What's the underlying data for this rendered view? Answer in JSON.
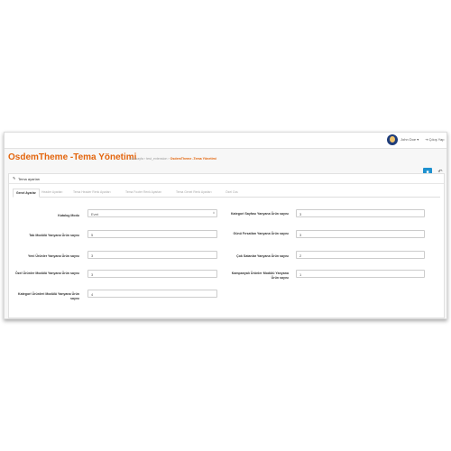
{
  "topbar": {
    "user_name": "John Doe ▾",
    "logout_label": "⇥ Çıkış Yap"
  },
  "header": {
    "title": "OsdemTheme -Tema Yönetimi",
    "breadcrumb": [
      "Anasayfa",
      "test_extension",
      "OsdemTheme -Tema Yönetimi"
    ],
    "breadcrumb_sep": " › "
  },
  "panel": {
    "title": "Tema ayarları"
  },
  "tabs": [
    "Genel Ayarlar",
    "Header Ayarları",
    "Tema Header Renk Ayarları",
    "Tema Footer Renk Ayarları",
    "Tema Genel Renk Ayarları",
    "Özel Css"
  ],
  "form": {
    "catalog_mode": {
      "label": "Katalog Modu",
      "value": "Evet"
    },
    "tab_module_count": {
      "label": "Tab Modülü Yanyana Ürün sayısı",
      "value": "5"
    },
    "new_products_count": {
      "label": "Yeni Ürünler Yanyana Ürün sayısı",
      "value": "3"
    },
    "special_products_module_count": {
      "label": "Özel Ürünler Modülü Yanyana Ürün sayısı",
      "value": "3"
    },
    "category_products_module_count": {
      "label": "Kategori Ürünleri Modülü Yanyana Ürün sayısı",
      "value": "4"
    },
    "category_page_count": {
      "label": "Kategori Sayfası Yanyana Ürün sayısı",
      "value": "3"
    },
    "daily_deal_count": {
      "label": "Günü Fırsatları Yanyana Ürün sayısı",
      "value": "3"
    },
    "bestseller_count": {
      "label": "Çok Satanlar Yanyana Ürün sayısı",
      "value": "2"
    },
    "campaign_products_module_count": {
      "label": "Kampanyalı Ürünler Modülü Yanyana Ürün sayısı",
      "value": "1"
    }
  },
  "icons": {
    "save": "save-icon",
    "back": "back-icon",
    "pencil": "pencil-icon"
  },
  "colors": {
    "accent": "#e3650d",
    "primary": "#1e91cf"
  }
}
